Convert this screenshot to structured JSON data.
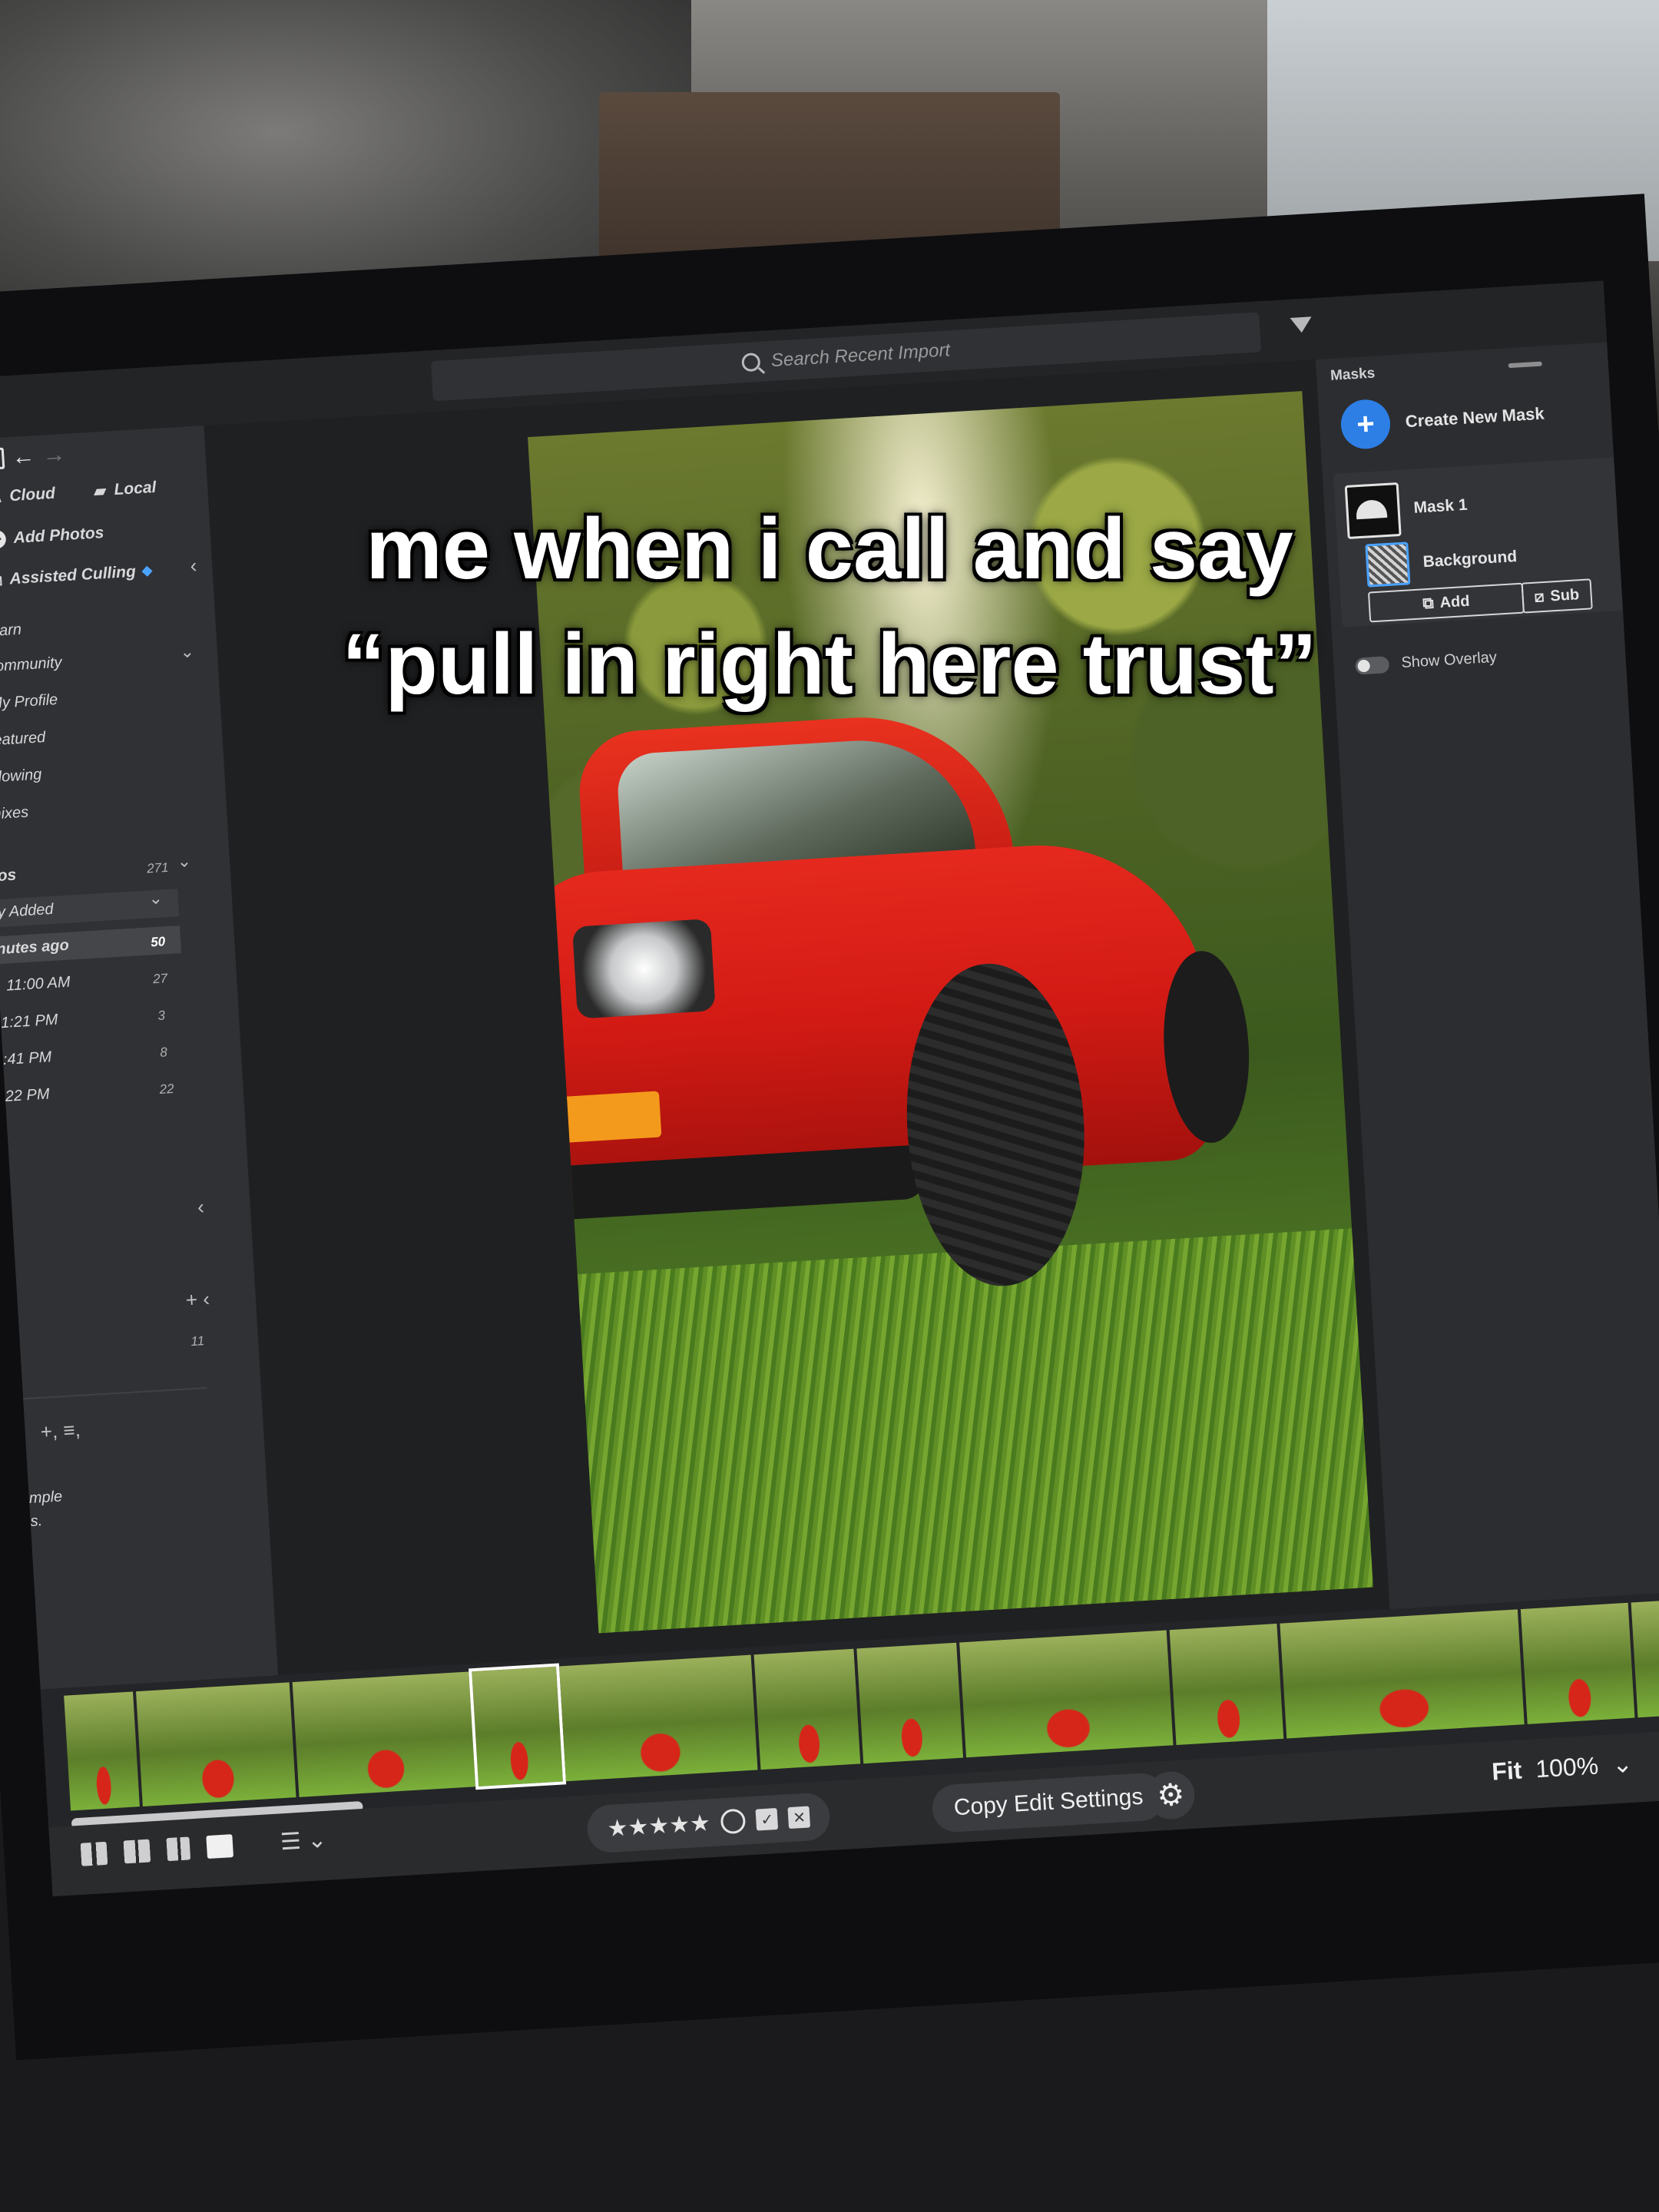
{
  "topbar": {
    "search_placeholder": "Search Recent Import"
  },
  "left_panel": {
    "tabs": [
      {
        "label": "Cloud"
      },
      {
        "label": "Local"
      }
    ],
    "add_photos": "Add Photos",
    "assisted_culling": "Assisted Culling",
    "nav_items": [
      {
        "label": "Learn"
      },
      {
        "label": "Community"
      },
      {
        "label": "My Profile"
      },
      {
        "label": "Featured"
      },
      {
        "label": "ollowing"
      },
      {
        "label": "mixes"
      }
    ],
    "photos_section": {
      "label": "tos",
      "count": "271"
    },
    "recently_added": "ly Added",
    "import_rows": [
      {
        "label": "nutes ago",
        "count": "50"
      },
      {
        "label": "11:00 AM",
        "count": "27"
      },
      {
        "label": "1:21 PM",
        "count": "3"
      },
      {
        "label": ":41 PM",
        "count": "8"
      },
      {
        "label": "22 PM",
        "count": "22"
      }
    ],
    "albums_count": "11",
    "footer_text_1": "mple",
    "footer_text_2": "s."
  },
  "masks_panel": {
    "title": "Masks",
    "create_new_mask": "Create New Mask",
    "mask_1": "Mask 1",
    "background": "Background",
    "add_label": "Add",
    "sub_label": "Sub",
    "show_overlay": "Show Overlay"
  },
  "filmstrip": {
    "thumbnail_count": 16,
    "selected_index": 3
  },
  "bottom_toolbar": {
    "stars": "★★★★★",
    "copy_edit_settings": "Copy Edit Settings",
    "fit_label": "Fit",
    "zoom_value": "100%"
  },
  "caption": {
    "line1": "me when i call and say",
    "line2": "“pull in right here trust”"
  },
  "colors": {
    "accent_blue": "#2d7fe6",
    "car_red": "#d21a14",
    "panel_bg": "#303134"
  }
}
